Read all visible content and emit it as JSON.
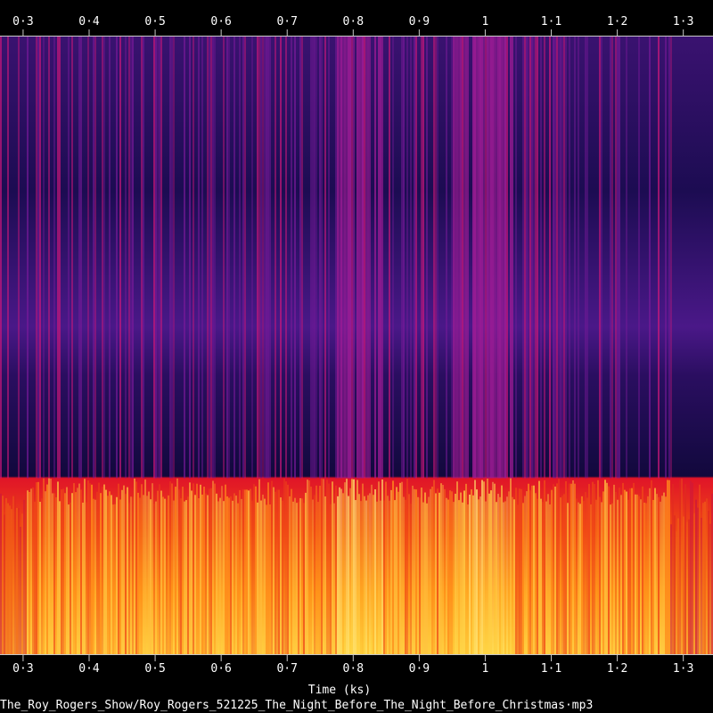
{
  "chart_data": {
    "type": "heatmap",
    "title": "",
    "xlabel": "Time (ks)",
    "ylabel": "",
    "xlim": [
      0.265,
      1.345
    ],
    "x_ticks": [
      {
        "value": 0.3,
        "label": "0·3"
      },
      {
        "value": 0.4,
        "label": "0·4"
      },
      {
        "value": 0.5,
        "label": "0·5"
      },
      {
        "value": 0.6,
        "label": "0·6"
      },
      {
        "value": 0.7,
        "label": "0·7"
      },
      {
        "value": 0.8,
        "label": "0·8"
      },
      {
        "value": 0.9,
        "label": "0·9"
      },
      {
        "value": 1.0,
        "label": "1"
      },
      {
        "value": 1.1,
        "label": "1·1"
      },
      {
        "value": 1.2,
        "label": "1·2"
      },
      {
        "value": 1.3,
        "label": "1·3"
      }
    ],
    "caption": "The_Roy_Rogers_Show/Roy_Rogers_521225_The_Night_Before_The_Night_Before_Christmas·mp3",
    "colormap": [
      "#000000",
      "#1a0a4a",
      "#5a0f8c",
      "#a0148c",
      "#e0141e",
      "#ff8c00",
      "#ffe650",
      "#ffffc8"
    ],
    "band_cutoff_fraction": 0.285,
    "bright_segments": [
      {
        "from": 0.775,
        "to": 0.845
      },
      {
        "from": 0.95,
        "to": 1.04
      }
    ],
    "quiet_segments": [
      {
        "from": 0.265,
        "to": 0.305
      },
      {
        "from": 1.28,
        "to": 1.345
      }
    ]
  }
}
